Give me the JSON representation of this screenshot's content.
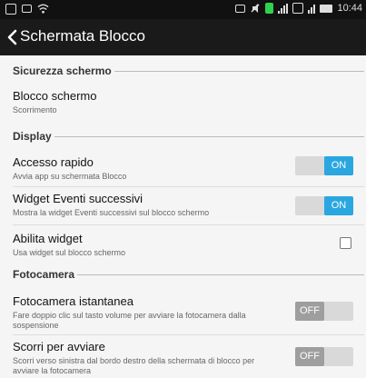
{
  "status_bar": {
    "time": "10:44"
  },
  "header": {
    "title": "Schermata Blocco"
  },
  "sections": {
    "security": "Sicurezza schermo",
    "display": "Display",
    "camera": "Fotocamera"
  },
  "items": {
    "screen_lock": {
      "title": "Blocco schermo",
      "subtitle": "Scorrimento"
    },
    "quick_access": {
      "title": "Accesso rapido",
      "subtitle": "Avvia app su schermata Blocco",
      "toggle_label": "ON",
      "state": "on"
    },
    "upcoming_events": {
      "title": "Widget Eventi successivi",
      "subtitle": "Mostra la widget Eventi successivi sul blocco schermo",
      "toggle_label": "ON",
      "state": "on"
    },
    "enable_widget": {
      "title": "Abilita widget",
      "subtitle": "Usa widget sul blocco schermo",
      "checked": false
    },
    "instant_camera": {
      "title": "Fotocamera istantanea",
      "subtitle": "Fare doppio clic sul tasto volume per avviare la fotocamera dalla sospensione",
      "toggle_label": "OFF",
      "state": "off"
    },
    "swipe_launch": {
      "title": "Scorri per avviare",
      "subtitle": "Scorri verso sinistra dal bordo destro della schermata di blocco per avviare la fotocamera",
      "toggle_label": "OFF",
      "state": "off"
    }
  },
  "colors": {
    "accent": "#2aa6e0",
    "off": "#9e9e9e",
    "header_bg": "#1a1a1a"
  }
}
